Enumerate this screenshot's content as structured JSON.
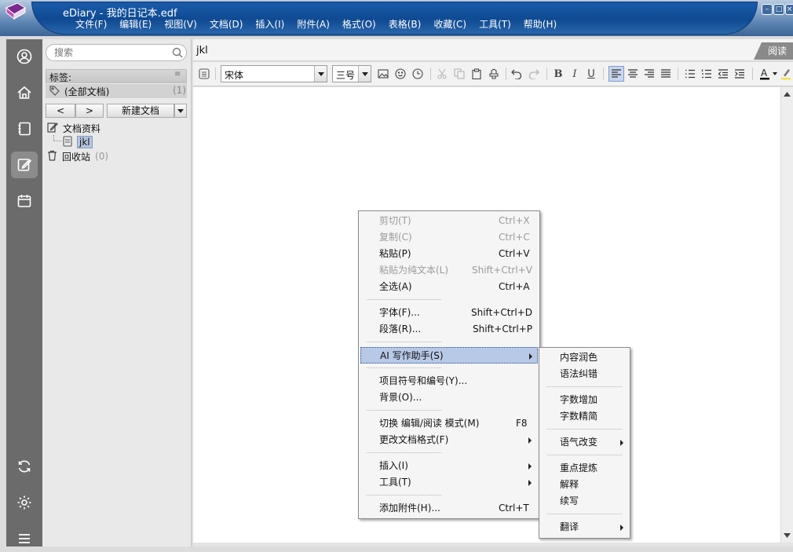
{
  "window": {
    "title": "eDiary - 我的日记本.edf",
    "menu": [
      "文件(F)",
      "编辑(E)",
      "视图(V)",
      "文档(D)",
      "插入(I)",
      "附件(A)",
      "格式(O)",
      "表格(B)",
      "收藏(C)",
      "工具(T)",
      "帮助(H)"
    ]
  },
  "sidebar": {
    "search_placeholder": "搜索",
    "tags_label": "标签:",
    "all_docs_label": "(全部文档)",
    "all_docs_count": "(1)",
    "back_btn": "<",
    "forward_btn": ">",
    "new_doc_btn": "新建文档",
    "tree": {
      "folder": "文档资料",
      "doc": "jkl",
      "trash": "回收站",
      "trash_count": "(0)"
    }
  },
  "document": {
    "title": "jkl",
    "read_tab": "阅读"
  },
  "toolbar": {
    "font_name": "宋体",
    "font_size": "三号"
  },
  "context_menu": {
    "items": [
      {
        "label": "剪切(T)",
        "shortcut": "Ctrl+X",
        "disabled": true
      },
      {
        "label": "复制(C)",
        "shortcut": "Ctrl+C",
        "disabled": true
      },
      {
        "label": "粘贴(P)",
        "shortcut": "Ctrl+V",
        "disabled": false
      },
      {
        "label": "粘贴为纯文本(L)",
        "shortcut": "Shift+Ctrl+V",
        "disabled": true
      },
      {
        "label": "全选(A)",
        "shortcut": "Ctrl+A",
        "disabled": false
      },
      {
        "label": "字体(F)...",
        "shortcut": "Shift+Ctrl+D",
        "disabled": false
      },
      {
        "label": "段落(R)...",
        "shortcut": "Shift+Ctrl+P",
        "disabled": false
      },
      {
        "label": "AI 写作助手(S)",
        "shortcut": "",
        "disabled": false
      },
      {
        "label": "项目符号和编号(Y)...",
        "shortcut": "",
        "disabled": false
      },
      {
        "label": "背景(O)...",
        "shortcut": "",
        "disabled": false
      },
      {
        "label": "切换 编辑/阅读 模式(M)",
        "shortcut": "F8",
        "disabled": false
      },
      {
        "label": "更改文档格式(F)",
        "shortcut": "",
        "disabled": false
      },
      {
        "label": "插入(I)",
        "shortcut": "",
        "disabled": false
      },
      {
        "label": "工具(T)",
        "shortcut": "",
        "disabled": false
      },
      {
        "label": "添加附件(H)...",
        "shortcut": "Ctrl+T",
        "disabled": false
      }
    ]
  },
  "ai_submenu": {
    "items": [
      "内容润色",
      "语法纠错",
      "字数增加",
      "字数精简",
      "语气改变",
      "重点提炼",
      "解释",
      "续写",
      "翻译"
    ]
  },
  "colors": {
    "title_blue": "#0f4a93",
    "rail_gray": "#6b6b6b",
    "highlight": "#b7c9e6"
  }
}
